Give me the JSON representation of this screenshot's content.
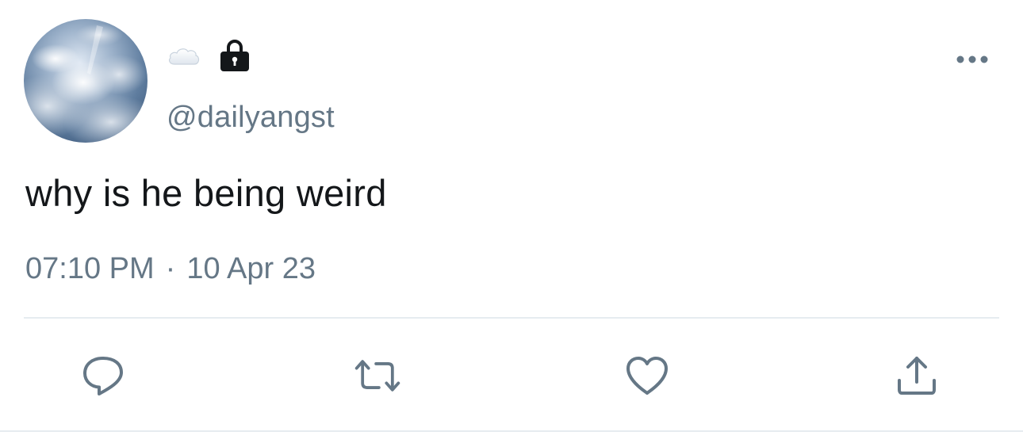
{
  "tweet": {
    "display_name_emoji": "cloud",
    "handle": "@dailyangst",
    "text": "why is he being weird",
    "time": "07:10 PM",
    "separator": "·",
    "date": "10 Apr 23"
  },
  "icons": {
    "name_emoji": "cloud-icon",
    "protected": "lock-icon",
    "more": "more-horizontal-icon",
    "reply": "reply-icon",
    "retweet": "retweet-icon",
    "like": "heart-icon",
    "share": "share-icon"
  },
  "colors": {
    "text": "#14171a",
    "secondary": "#657786",
    "divider": "#e6ecf0",
    "background": "#ffffff"
  }
}
